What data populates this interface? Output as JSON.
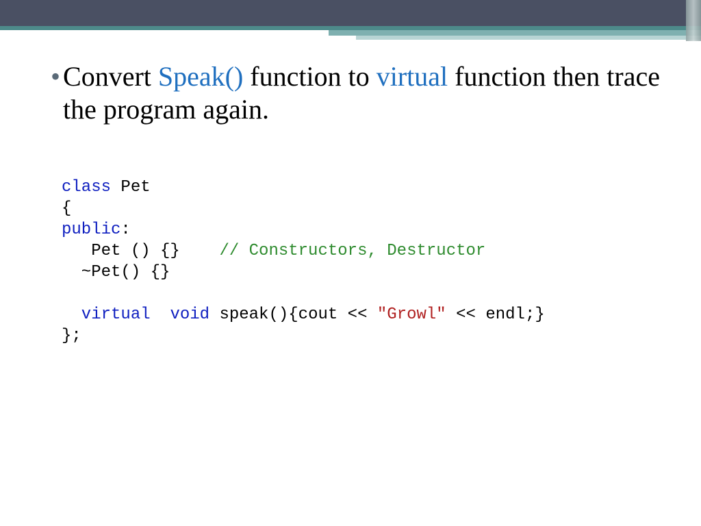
{
  "bullet": {
    "t1": "Convert ",
    "t2": "Speak()",
    "t3": " function to ",
    "t4": "virtual",
    "t5": " function then trace the program again."
  },
  "code": {
    "l1a": "class",
    "l1b": " Pet",
    "l2": "{",
    "l3a": "public",
    "l3b": ":",
    "l4a": "   Pet () {}    ",
    "l4b": "// Constructors, Destructor",
    "l5": "  ~Pet() {}",
    "l6": "",
    "l7a": "  virtual",
    "l7b": "  ",
    "l7c": "void",
    "l7d": " speak(){cout << ",
    "l7e": "\"Growl\"",
    "l7f": " << endl;}",
    "l8": "};"
  }
}
